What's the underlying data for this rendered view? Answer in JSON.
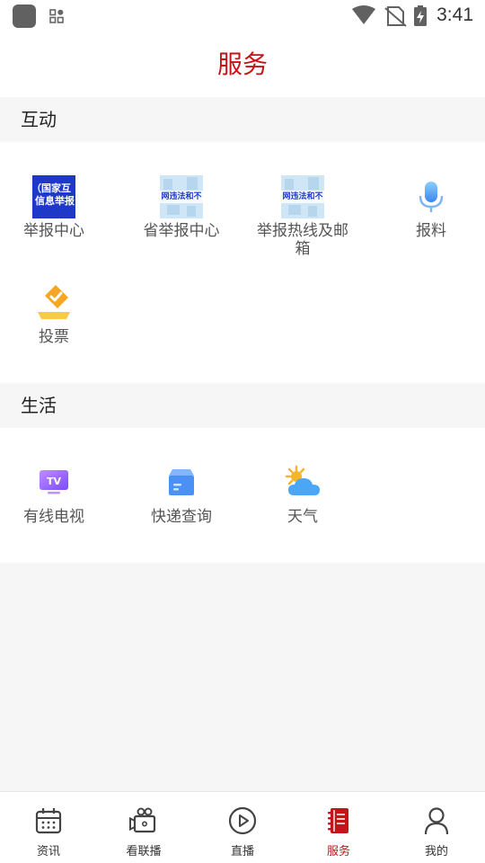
{
  "status_bar": {
    "time": "3:41",
    "icons": [
      "app-icon",
      "grid-icon",
      "wifi-icon",
      "no-sim-icon",
      "battery-charging-icon"
    ]
  },
  "page": {
    "title": "服务"
  },
  "sections": [
    {
      "title": "互动",
      "items": [
        {
          "label": "举报中心",
          "icon": "report-center-thumbnail",
          "image_text": [
            "（国家互",
            "信息举报"
          ]
        },
        {
          "label": "省举报中心",
          "icon": "provincial-report-thumbnail",
          "image_text": "网违法和不"
        },
        {
          "label": "举报热线及邮箱",
          "icon": "hotline-mailbox-thumbnail",
          "image_text": "网违法和不"
        },
        {
          "label": "报料",
          "icon": "microphone-icon"
        },
        {
          "label": "投票",
          "icon": "vote-icon"
        }
      ]
    },
    {
      "title": "生活",
      "items": [
        {
          "label": "有线电视",
          "icon": "tv-icon",
          "icon_text": "TV"
        },
        {
          "label": "快递查询",
          "icon": "parcel-icon"
        },
        {
          "label": "天气",
          "icon": "weather-icon"
        }
      ]
    }
  ],
  "tabbar": {
    "active_index": 3,
    "accent_color": "#c3141a",
    "items": [
      {
        "label": "资讯",
        "icon": "calendar-icon"
      },
      {
        "label": "看联播",
        "icon": "video-camera-icon"
      },
      {
        "label": "直播",
        "icon": "play-circle-icon"
      },
      {
        "label": "服务",
        "icon": "notebook-icon"
      },
      {
        "label": "我的",
        "icon": "user-icon"
      }
    ]
  },
  "colors": {
    "brand": "#c3141a",
    "page_background": "#f6f6f6"
  }
}
